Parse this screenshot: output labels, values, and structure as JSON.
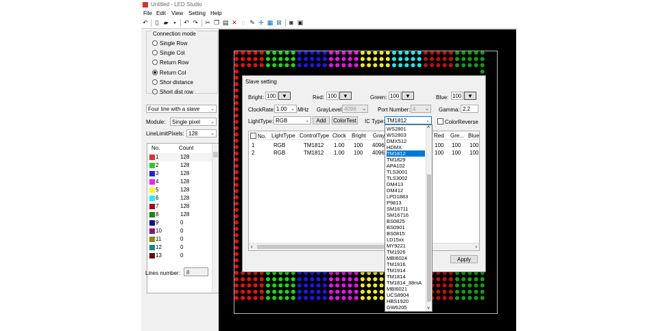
{
  "window": {
    "title": "Untitled - LED Studio"
  },
  "menu": [
    "File",
    "Edit",
    "View",
    "Setting",
    "Help"
  ],
  "toolbar_icons": [
    "undo-icon",
    "new-file-icon",
    "open-folder-icon",
    "save-icon",
    "undo-arrow-icon",
    "redo-arrow-icon",
    "cut-icon",
    "copy-icon",
    "paste-icon",
    "delete-icon",
    "lasso-icon",
    "pen-icon",
    "crosshair-icon",
    "grid-icon",
    "fit-icon",
    "binoculars-icon",
    "image-icon"
  ],
  "connection": {
    "title": "Connection mode",
    "options": [
      "Single Row",
      "Single Col",
      "Return Row",
      "Return Col",
      "Shor distance",
      "Short dist row"
    ],
    "selected": "Return Col"
  },
  "slave_combo": "Four line with a slave",
  "module": {
    "label": "Module:",
    "value": "Single pixel"
  },
  "linelimit": {
    "label": "LineLimitPixels:",
    "value": "128"
  },
  "lines_list": {
    "headers": [
      "No.",
      "Count"
    ],
    "rows": [
      {
        "no": "1",
        "count": "128",
        "color": "#e03030"
      },
      {
        "no": "2",
        "count": "128",
        "color": "#2ecc2e"
      },
      {
        "no": "3",
        "count": "128",
        "color": "#2020e8"
      },
      {
        "no": "4",
        "count": "128",
        "color": "#ee22ee"
      },
      {
        "no": "5",
        "count": "128",
        "color": "#f5f520"
      },
      {
        "no": "6",
        "count": "128",
        "color": "#22eeee"
      },
      {
        "no": "7",
        "count": "128",
        "color": "#a01010"
      },
      {
        "no": "8",
        "count": "128",
        "color": "#108a10"
      },
      {
        "no": "9",
        "count": "0",
        "color": "#101090"
      },
      {
        "no": "10",
        "count": "0",
        "color": "#8a108a"
      },
      {
        "no": "11",
        "count": "0",
        "color": "#8a8a10"
      },
      {
        "no": "12",
        "count": "0",
        "color": "#108a8a"
      },
      {
        "no": "13",
        "count": "0",
        "color": "#601010"
      }
    ]
  },
  "lines_number": {
    "label": "Lines number:",
    "value": "8"
  },
  "slave_dialog": {
    "title": "Slave setting",
    "bright": {
      "label": "Bright:",
      "value": "100"
    },
    "red": {
      "label": "Red:",
      "value": "100"
    },
    "green": {
      "label": "Green:",
      "value": "100"
    },
    "blue": {
      "label": "Blue:",
      "value": "100"
    },
    "clockrate": {
      "label": "ClockRate:",
      "value": "1.00",
      "unit": "MHz"
    },
    "graylevel": {
      "label": "GrayLevel:",
      "value": "4096"
    },
    "portnumber": {
      "label": "Port Number:",
      "value": "4"
    },
    "gamma": {
      "label": "Gamma:",
      "value": "2.2"
    },
    "lighttype": {
      "label": "LightType:",
      "value": "RGB"
    },
    "add_label": "Add",
    "colortest_label": "ColorTest",
    "ictype": {
      "label": "IC Type:",
      "value": "TM1812"
    },
    "colorreverse_label": "ColorReverse",
    "table": {
      "headers": [
        "No.",
        "LightType",
        "ControlType",
        "Clock",
        "Bright",
        "Gray",
        "Red",
        "Gre...",
        "Blue"
      ],
      "rows": [
        [
          "1",
          "RGB",
          "TM1812",
          "1.00",
          "100",
          "4096",
          "100",
          "100",
          "100"
        ],
        [
          "2",
          "RGB",
          "TM1812",
          "1.00",
          "100",
          "4096",
          "100",
          "100",
          "100"
        ]
      ]
    },
    "cancel_label": "ncel",
    "apply_label": "Apply"
  },
  "ic_dropdown": {
    "items": [
      "WS2801",
      "WS2803",
      "DMX512",
      "HDMX",
      "TM1812",
      "TM1829",
      "APA102",
      "TLS3001",
      "TLS3002",
      "DM413",
      "DM412",
      "LPD1883",
      "P9813",
      "SM16711",
      "SM16716",
      "BS0825",
      "BS0901",
      "BS0815",
      "LD15xx",
      "MY9221",
      "TM1926",
      "MBI6024",
      "TM1916",
      "TM1914",
      "TM1814",
      "TM1814_38mA",
      "MBI6021",
      "UCS8904",
      "HBS1920",
      "GW6205"
    ],
    "selected": "TM1812"
  },
  "led_colors": {
    "top_sequence": [
      "#e81010",
      "#10e010",
      "#1818f0",
      "#f010f0",
      "#f0f010",
      "#10f0f0",
      "#c01010",
      "#10a010"
    ],
    "side_left": "#e81010",
    "side_right": "#10a010"
  }
}
